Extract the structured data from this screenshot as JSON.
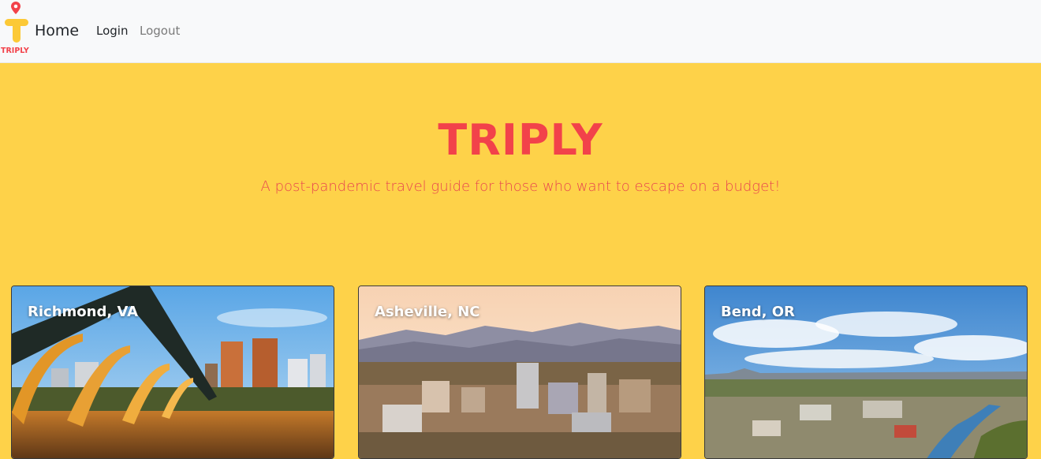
{
  "nav": {
    "logo_text": "TRIPLY",
    "brand_label": "Home",
    "links": [
      {
        "label": "Login"
      },
      {
        "label": "Logout"
      }
    ]
  },
  "hero": {
    "title": "TRIPLY",
    "subtitle": "A post-pandemic travel guide for those who want to escape on a budget!"
  },
  "cards": [
    {
      "title": "Richmond, VA"
    },
    {
      "title": "Asheville, NC"
    },
    {
      "title": "Bend, OR"
    }
  ],
  "colors": {
    "hero_background": "#FED249",
    "brand_red": "#F2424A",
    "navbar_background": "#F8F9FA"
  }
}
